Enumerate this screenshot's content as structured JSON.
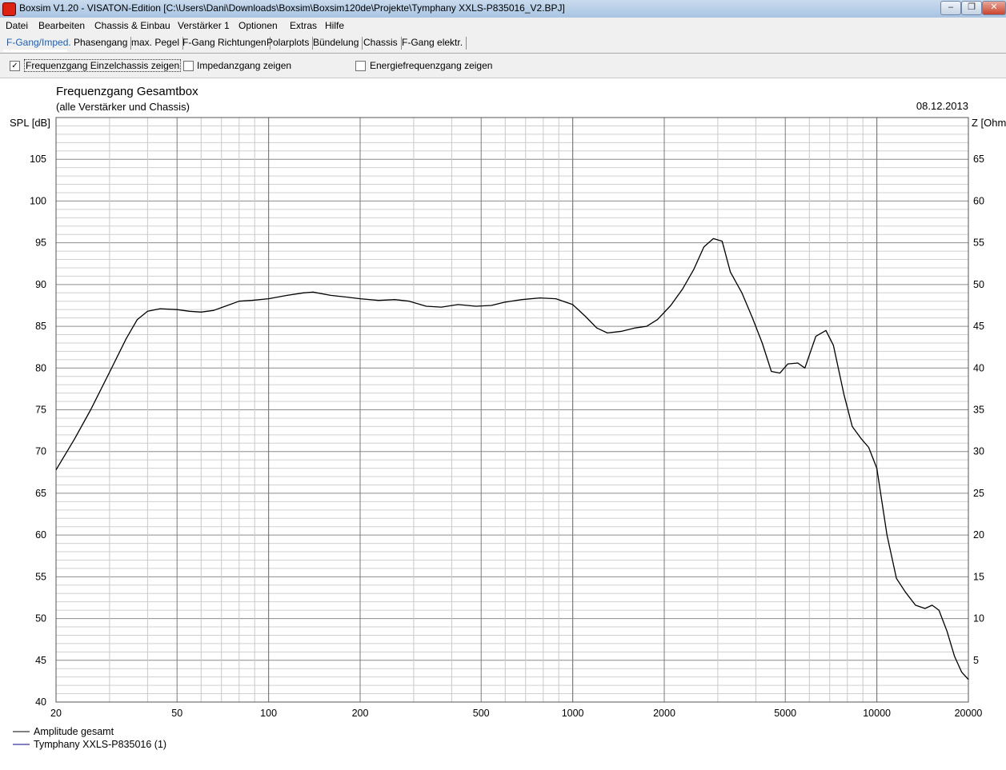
{
  "window": {
    "title": "Boxsim V1.20 - VISATON-Edition [C:\\Users\\Dani\\Downloads\\Boxsim\\Boxsim120de\\Projekte\\Tymphany XXLS-P835016_V2.BPJ]"
  },
  "menu": [
    "Datei",
    "Bearbeiten",
    "Chassis & Einbau",
    "Verstärker 1",
    "Optionen",
    "Extras",
    "Hilfe"
  ],
  "tabs": [
    "F-Gang/Imped.",
    "Phasengang",
    "max. Pegel",
    "F-Gang Richtungen",
    "Polarplots",
    "Bündelung",
    "Chassis",
    "F-Gang elektr."
  ],
  "active_tab": 0,
  "options": [
    {
      "label": "Frequenzgang Einzelchassis zeigen",
      "checked": true
    },
    {
      "label": "Impedanzgang zeigen",
      "checked": false
    },
    {
      "label": "Energiefrequenzgang zeigen",
      "checked": false
    }
  ],
  "chart_data": {
    "type": "line",
    "title": "Frequenzgang Gesamtbox",
    "subtitle": "(alle Verstärker und Chassis)",
    "date": "08.12.2013",
    "ylabel": "SPL [dB]",
    "y2label": "Z [Ohm",
    "x_scale": "log",
    "xlim": [
      20,
      20000
    ],
    "ylim": [
      40,
      110
    ],
    "y2lim": [
      0,
      70
    ],
    "x_ticks": [
      "20",
      "50",
      "100",
      "200",
      "500",
      "1000",
      "2000",
      "5000",
      "10000",
      "20000"
    ],
    "y_ticks": [
      "40",
      "45",
      "50",
      "55",
      "60",
      "65",
      "70",
      "75",
      "80",
      "85",
      "90",
      "95",
      "100",
      "105"
    ],
    "y2_ticks": [
      "5",
      "10",
      "15",
      "20",
      "25",
      "30",
      "35",
      "40",
      "45",
      "50",
      "55",
      "60",
      "65"
    ],
    "grid": true,
    "legend_position": "bottom-left",
    "series": [
      {
        "name": "Amplitude gesamt",
        "color": "#000000",
        "x": [
          20,
          23,
          26,
          30,
          34,
          37,
          40,
          44,
          50,
          55,
          60,
          66,
          72,
          80,
          88,
          100,
          115,
          130,
          140,
          160,
          180,
          200,
          230,
          260,
          290,
          330,
          370,
          420,
          480,
          540,
          600,
          680,
          780,
          880,
          1000,
          1100,
          1200,
          1300,
          1450,
          1600,
          1750,
          1900,
          2100,
          2300,
          2500,
          2700,
          2900,
          3100,
          3300,
          3600,
          3900,
          4200,
          4500,
          4800,
          5100,
          5500,
          5800,
          6300,
          6800,
          7200,
          7800,
          8300,
          8900,
          9400,
          10000,
          10800,
          11600,
          12400,
          13400,
          14400,
          15200,
          16000,
          17000,
          18000,
          19000,
          20000
        ],
        "y": [
          67.8,
          71.5,
          75.0,
          79.5,
          83.5,
          85.8,
          86.8,
          87.1,
          87.0,
          86.8,
          86.7,
          86.9,
          87.4,
          88.0,
          88.1,
          88.3,
          88.7,
          89.0,
          89.1,
          88.7,
          88.5,
          88.3,
          88.1,
          88.2,
          88.0,
          87.4,
          87.3,
          87.6,
          87.4,
          87.5,
          87.9,
          88.2,
          88.4,
          88.3,
          87.6,
          86.2,
          84.8,
          84.2,
          84.4,
          84.8,
          85.0,
          85.8,
          87.5,
          89.5,
          91.8,
          94.5,
          95.5,
          95.2,
          91.5,
          89.0,
          86.0,
          83.0,
          79.6,
          79.4,
          80.5,
          80.6,
          80.0,
          83.8,
          84.5,
          82.7,
          76.8,
          73.0,
          71.5,
          70.5,
          68.0,
          60.0,
          54.8,
          53.2,
          51.6,
          51.2,
          51.6,
          51.0,
          48.5,
          45.5,
          43.6,
          42.7
        ]
      },
      {
        "name": "Tymphany XXLS-P835016 (1)",
        "color": "#000080"
      }
    ]
  }
}
